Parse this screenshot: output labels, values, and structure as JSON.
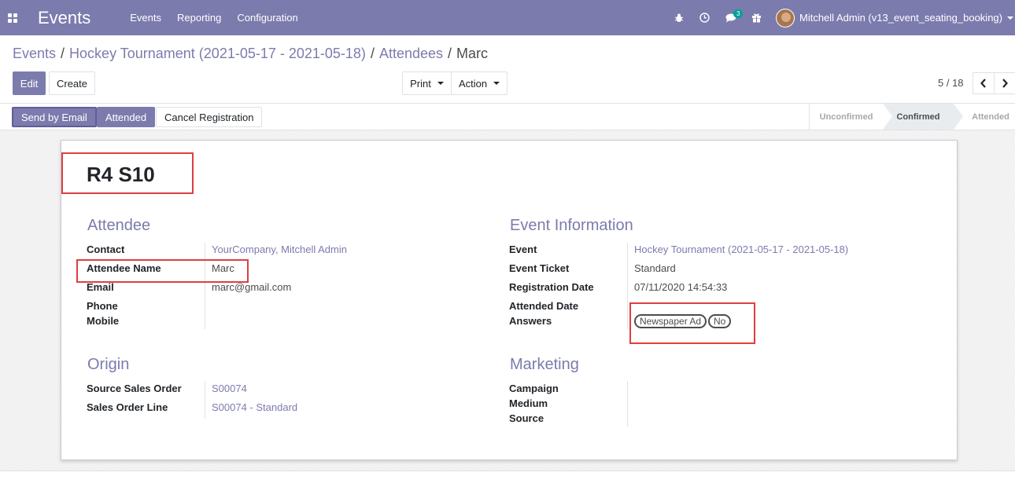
{
  "navbar": {
    "brand": "Events",
    "menu": [
      "Events",
      "Reporting",
      "Configuration"
    ],
    "message_count": "3",
    "user": "Mitchell Admin (v13_event_seating_booking)"
  },
  "breadcrumb": [
    "Events",
    "Hockey Tournament (2021-05-17 - 2021-05-18)",
    "Attendees",
    "Marc"
  ],
  "toolbar": {
    "edit": "Edit",
    "create": "Create",
    "print": "Print",
    "action": "Action",
    "pager": "5 / 18"
  },
  "statusbar": {
    "send_email": "Send by Email",
    "attended": "Attended",
    "cancel": "Cancel Registration",
    "stages": [
      "Unconfirmed",
      "Confirmed",
      "Attended"
    ],
    "active_stage": "Confirmed"
  },
  "form": {
    "title": "R4 S10",
    "attendee": {
      "title": "Attendee",
      "contact_label": "Contact",
      "contact": "YourCompany, Mitchell Admin",
      "name_label": "Attendee Name",
      "name": "Marc",
      "email_label": "Email",
      "email": "marc@gmail.com",
      "phone_label": "Phone",
      "phone": "",
      "mobile_label": "Mobile",
      "mobile": ""
    },
    "event_info": {
      "title": "Event Information",
      "event_label": "Event",
      "event": "Hockey Tournament (2021-05-17 - 2021-05-18)",
      "ticket_label": "Event Ticket",
      "ticket": "Standard",
      "reg_date_label": "Registration Date",
      "reg_date": "07/11/2020 14:54:33",
      "att_date_label": "Attended Date",
      "att_date": "",
      "answers_label": "Answers",
      "answers": [
        "Newspaper Ad",
        "No"
      ]
    },
    "origin": {
      "title": "Origin",
      "so_label": "Source Sales Order",
      "so": "S00074",
      "sol_label": "Sales Order Line",
      "sol": "S00074 - Standard"
    },
    "marketing": {
      "title": "Marketing",
      "campaign_label": "Campaign",
      "medium_label": "Medium",
      "source_label": "Source"
    }
  },
  "colors": {
    "primary": "#7c7bad",
    "highlight": "#e03e3e"
  }
}
